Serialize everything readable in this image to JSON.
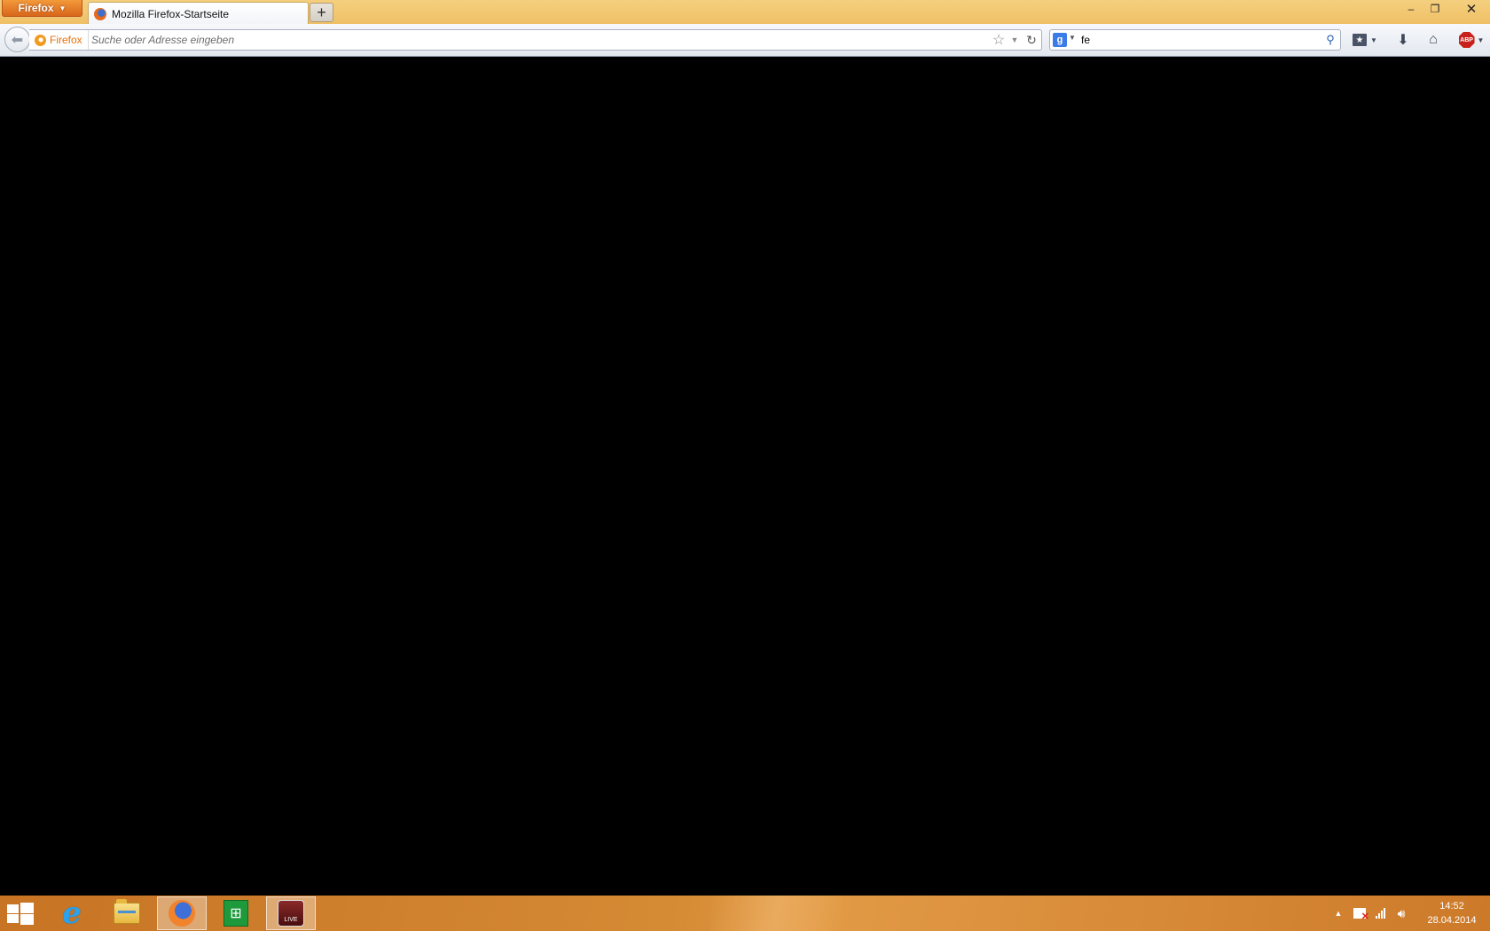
{
  "browser": {
    "menu_label": "Firefox",
    "tab": {
      "title": "Mozilla Firefox-Startseite"
    },
    "new_tab_label": "+"
  },
  "window_controls": {
    "minimize": "–",
    "maximize": "❐",
    "close": "✕"
  },
  "navbar": {
    "identity_label": "Firefox",
    "url_placeholder": "Suche oder Adresse eingeben",
    "url_value": "",
    "search_engine_letter": "g",
    "search_value": "fe"
  },
  "toolbar_icons": [
    "bookmarks-icon",
    "download-icon",
    "home-icon",
    "adblock-plus-icon"
  ],
  "adblock_label": "ABP",
  "taskbar": {
    "apps": [
      {
        "name": "internet-explorer",
        "active": false
      },
      {
        "name": "file-explorer",
        "active": false
      },
      {
        "name": "firefox",
        "active": true
      },
      {
        "name": "windows-store",
        "active": false
      },
      {
        "name": "live",
        "label": "LIVE",
        "active": false
      }
    ],
    "clock": {
      "time": "14:52",
      "date": "28.04.2014"
    }
  },
  "colors": {
    "titlebar": "#f0c56e",
    "menu_button": "#e07a28",
    "content_bg": "#000000",
    "taskbar": "#d08030"
  }
}
